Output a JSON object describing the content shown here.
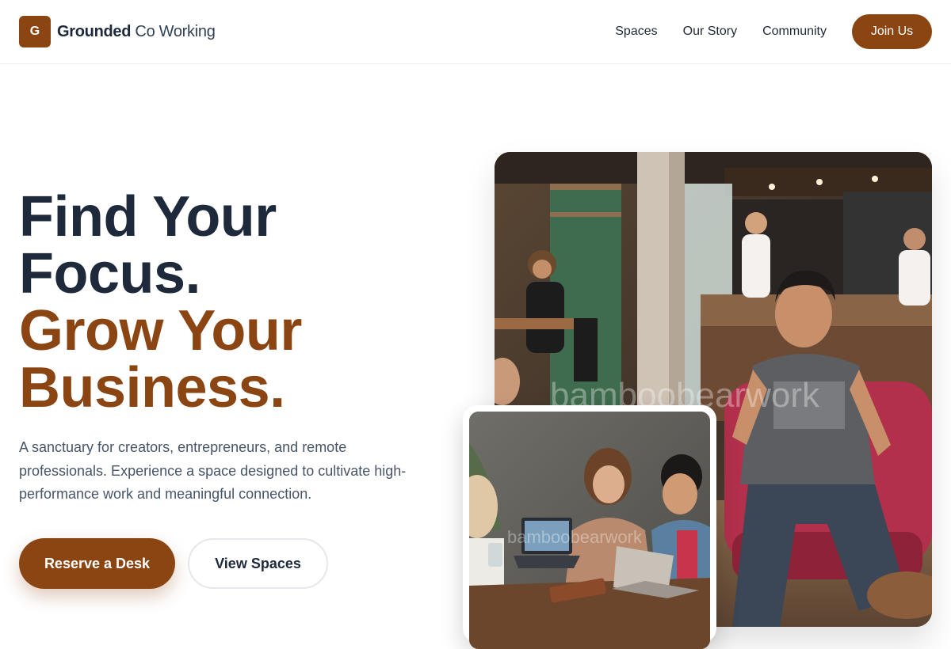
{
  "brand": {
    "logo_letter": "G",
    "name_bold": "Grounded",
    "name_light": "Co Working"
  },
  "nav": {
    "links": [
      "Spaces",
      "Our Story",
      "Community"
    ],
    "cta": "Join Us"
  },
  "hero": {
    "headline_line1": "Find Your",
    "headline_line2": "Focus.",
    "headline_line3": "Grow Your",
    "headline_line4": "Business.",
    "subtext": "A sanctuary for creators, entrepreneurs, and remote professionals. Experience a space designed to cultivate high-performance work and meaningful connection.",
    "primary_button": "Reserve a Desk",
    "secondary_button": "View Spaces"
  },
  "images": {
    "main_watermark": "bamboobearwork",
    "small_watermark": "bamboobearwork"
  },
  "colors": {
    "accent": "#8b4513",
    "heading": "#1e293b",
    "body_text": "#475569"
  }
}
